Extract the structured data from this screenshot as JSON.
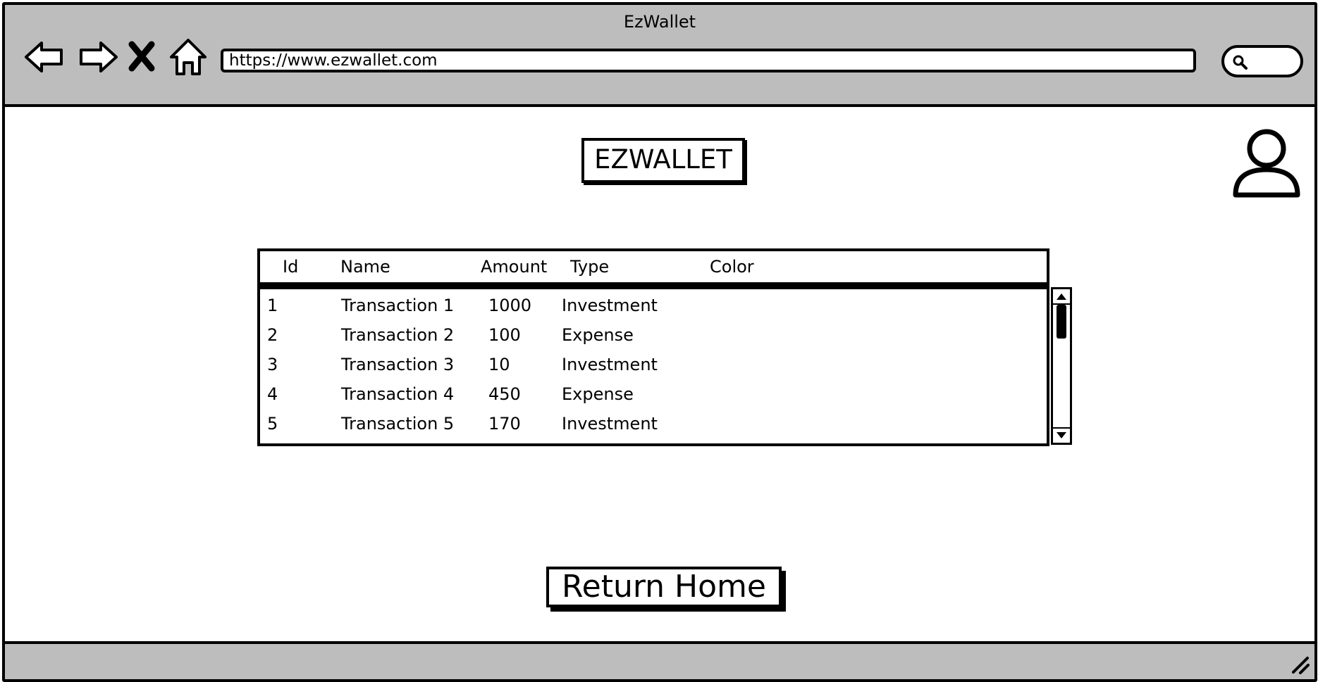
{
  "window": {
    "title": "EzWallet"
  },
  "browser": {
    "url": "https://www.ezwallet.com",
    "nav_icons": [
      "back-arrow-icon",
      "forward-arrow-icon",
      "close-x-icon",
      "home-icon"
    ],
    "search_icon": "search-icon",
    "chrome_color": "#bdbdbd"
  },
  "page": {
    "app_title": "EZWALLET",
    "profile_icon": "user-icon",
    "return_button_label": "Return Home"
  },
  "table": {
    "columns": [
      "Id",
      "Name",
      "Amount",
      "Type",
      "Color"
    ],
    "rows": [
      {
        "id": "1",
        "name": "Transaction 1",
        "amount": "1000",
        "type": "Investment",
        "color": ""
      },
      {
        "id": "2",
        "name": "Transaction 2",
        "amount": "100",
        "type": "Expense",
        "color": ""
      },
      {
        "id": "3",
        "name": "Transaction 3",
        "amount": "10",
        "type": "Investment",
        "color": ""
      },
      {
        "id": "4",
        "name": "Transaction 4",
        "amount": "450",
        "type": "Expense",
        "color": ""
      },
      {
        "id": "5",
        "name": "Transaction 5",
        "amount": "170",
        "type": "Investment",
        "color": ""
      }
    ]
  }
}
